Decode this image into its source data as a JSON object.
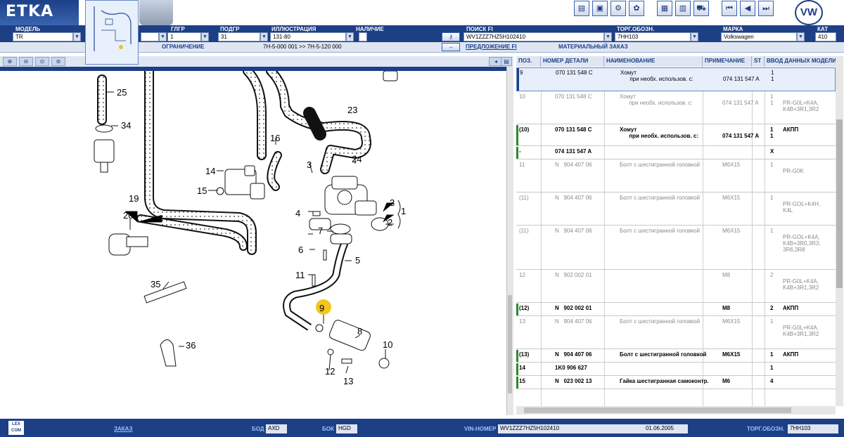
{
  "app": {
    "title": "ETKA"
  },
  "selectors": [
    {
      "label": "МОДЕЛЬ",
      "value": "TR"
    },
    {
      "label": "",
      "value": ""
    },
    {
      "label": "ГЛГР",
      "value": "1"
    },
    {
      "label": "ПОДГР",
      "value": "31"
    },
    {
      "label": "ИЛЛЮСТРАЦИЯ",
      "value": "131-80"
    },
    {
      "label": "НАЛИЧИЕ",
      "value": ""
    },
    {
      "label": "ПОИСК FI",
      "value": "WV1ZZZ7HZ5H102410"
    },
    {
      "label": "ТОРГ.ОБОЗН.",
      "value": "7HH103"
    },
    {
      "label": "МАРКА",
      "value": "Volkswagen"
    },
    {
      "label": "КАТ",
      "value": "410"
    }
  ],
  "lower": {
    "restriction_label": "ОГРАНИЧЕНИЕ",
    "restriction_value": "7H-5-000 001 >> 7H-5-120 000",
    "proposal_label": "ПРЕДЛОЖЕНИЕ FI",
    "material_label": "МАТЕРИАЛЬНЫЙ ЗАКАЗ"
  },
  "table": {
    "headers": [
      "ПОЗ.",
      "НОМЕР ДЕТАЛИ",
      "НАИМЕНОВАНИЕ",
      "ПРИМЕЧАНИЕ",
      "ST",
      "ВВОД ДАННЫХ МОДЕЛИ"
    ],
    "rows": [
      {
        "pos": "9",
        "part": "070 131 548 C",
        "name": "Хомут\n      при необх. использов. с:",
        "note": "\n074 131 547 A",
        "st": "1\n1",
        "model": "",
        "style": "sel"
      },
      {
        "pos": "10",
        "part": "070 131 548 C",
        "name": "Хомут\n      при необх. использов. с:",
        "note": "\n074 131 547 A",
        "st": "1\n1",
        "model": "\nPR-G0L+K4A,\nK4B+3R1,3R2",
        "style": "dim"
      },
      {
        "pos": "(10)",
        "part": "070 131 548 C",
        "name": "Хомут\n      при необх. использов. с:",
        "note": "\n074 131 547 A",
        "st": "1\n1",
        "model": "АКПП",
        "style": "bold"
      },
      {
        "pos": "-",
        "part": "074 131 547 A",
        "name": "",
        "note": "",
        "st": "X",
        "model": "",
        "style": "bold"
      },
      {
        "pos": "11",
        "part": "N   904 407 06",
        "name": "Болт с шестигранной головкой",
        "note": "M6X15",
        "st": "1",
        "model": "\nPR-G0K",
        "style": "dim"
      },
      {
        "pos": "(11)",
        "part": "N   904 407 06",
        "name": "Болт с шестигранной головкой",
        "note": "M6X15",
        "st": "1",
        "model": "\nPR-GOL+K4H,\nK4L",
        "style": "dim"
      },
      {
        "pos": "(11)",
        "part": "N   904 407 06",
        "name": "Болт с шестигранной головкой",
        "note": "M6X15",
        "st": "1",
        "model": "\nPR-GOL+K4A,\nK4B+3R0,3R3,\n3R6,3R8",
        "style": "dim"
      },
      {
        "pos": "12",
        "part": "N   902 002 01",
        "name": "",
        "note": "M8",
        "st": "2",
        "model": "\nPR-G0L+K4A,\nK4B+3R1,3R2",
        "style": "dim"
      },
      {
        "pos": "(12)",
        "part": "N   902 002 01",
        "name": "",
        "note": "M8",
        "st": "2",
        "model": "АКПП",
        "style": "bold"
      },
      {
        "pos": "13",
        "part": "N   904 407 06",
        "name": "Болт с шестигранной головкой",
        "note": "M6X15",
        "st": "1",
        "model": "\nPR-G0L+K4A,\nK4B+3R1,3R2",
        "style": "dim"
      },
      {
        "pos": "(13)",
        "part": "N   904 407 06",
        "name": "Болт с шестигранной головкой",
        "note": "M6X15",
        "st": "1",
        "model": "АКПП",
        "style": "bold"
      },
      {
        "pos": "14",
        "part": "1K0 906 627",
        "name": "",
        "note": "",
        "st": "1",
        "model": "",
        "style": "bold"
      },
      {
        "pos": "15",
        "part": "N   023 002 13",
        "name": "Гайка шестигранная самоконтр.",
        "note": "M6",
        "st": "4",
        "model": "",
        "style": "bold"
      }
    ]
  },
  "diagram": {
    "labels": [
      "25",
      "34",
      "16",
      "14",
      "15",
      "19",
      "20",
      "23",
      "24",
      "3",
      "3",
      "1",
      "4",
      "7",
      "2",
      "6",
      "5",
      "11",
      "9",
      "8",
      "10",
      "12",
      "13",
      "35",
      "36"
    ],
    "highlight": "9"
  },
  "status": {
    "order_label": "ЗАКАЗ",
    "bod_label": "БОД",
    "bod_value": "AXD",
    "bok_label": "БОК",
    "bok_value": "HGD",
    "vin_label": "VIN-НОМЕР",
    "vin_value": "WV1ZZZ7HZ5H102410",
    "date_value": "01.06.2005",
    "torg_label": "ТОРГ.ОБОЗН.",
    "torg_value": "7HH103",
    "lex_text": "LEX COM"
  }
}
